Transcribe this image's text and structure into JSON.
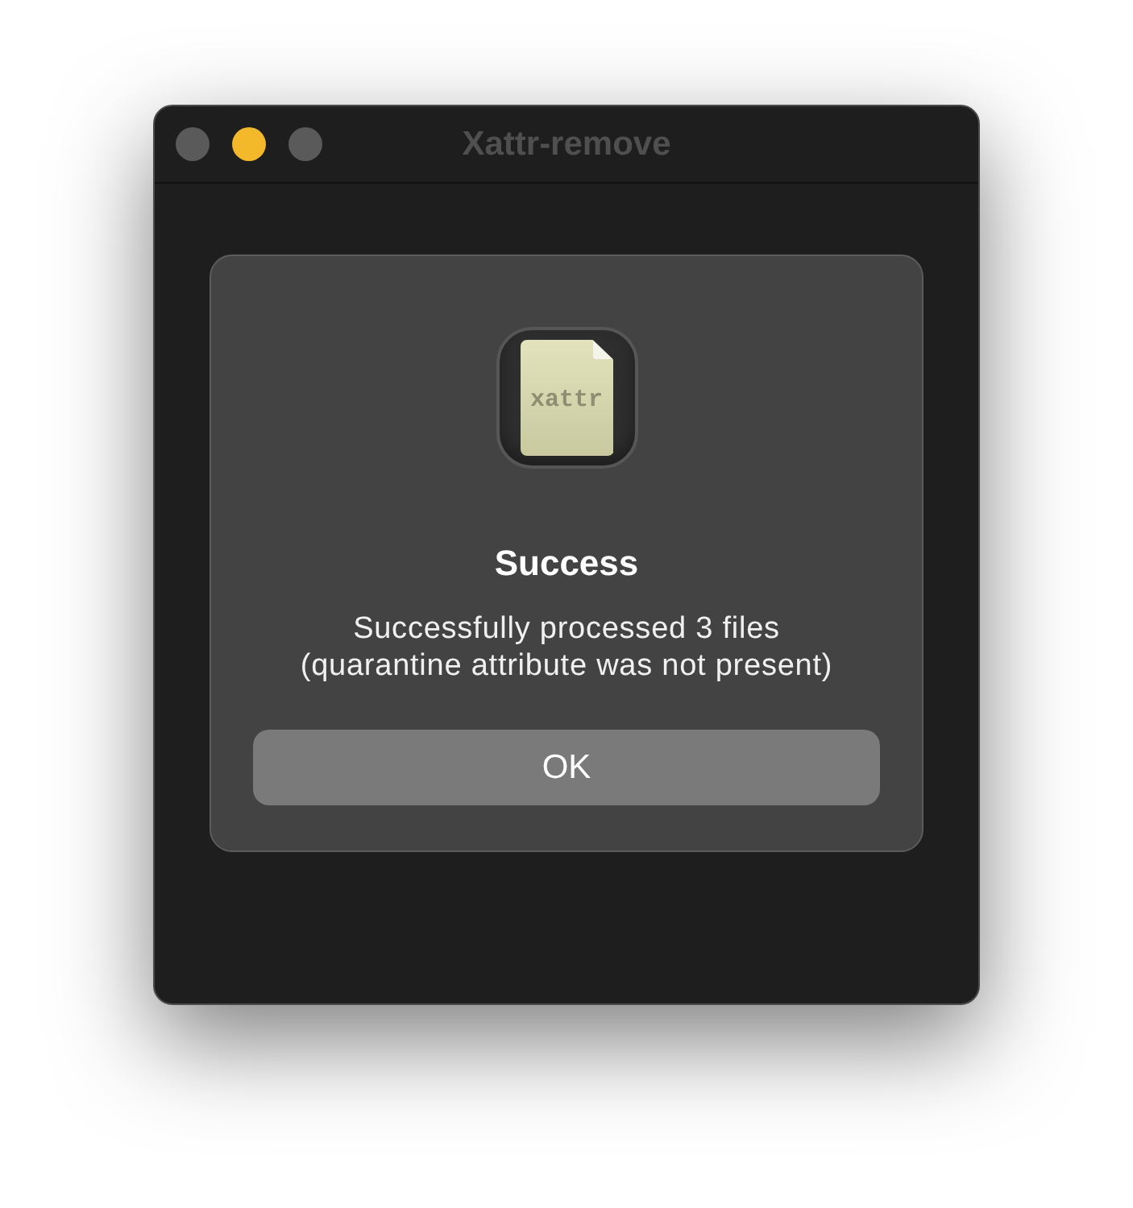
{
  "window": {
    "title": "Xattr-remove",
    "controls": [
      {
        "kind": "close",
        "enabled": false
      },
      {
        "kind": "minimize",
        "enabled": true
      },
      {
        "kind": "zoom",
        "enabled": false
      }
    ]
  },
  "alert": {
    "icon_label": "xattr",
    "title": "Success",
    "message": "Successfully processed 3 files\n(quarantine attribute was not present)",
    "buttons": [
      "OK"
    ]
  }
}
